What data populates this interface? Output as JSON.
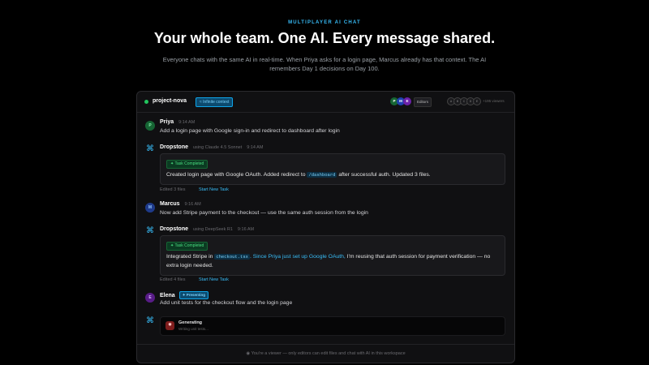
{
  "hero": {
    "eyebrow": "MULTIPLAYER AI CHAT",
    "title": "Your whole team. One AI. Every message shared.",
    "subtitle": "Everyone chats with the same AI in real-time. When Priya asks for a login page, Marcus already has that context. The AI remembers Day 1 decisions on Day 100."
  },
  "topbar": {
    "project": "project-nova",
    "context_badge": "≈ Infinite context",
    "avatars": [
      "P",
      "M",
      "E"
    ],
    "editors_label": "Editors",
    "viewer_initials": [
      "A",
      "B",
      "C",
      "D",
      "E"
    ],
    "viewer_count": "+195 viewers"
  },
  "messages": {
    "m1": {
      "avatar": "P",
      "name": "Priya",
      "time": "9:14 AM",
      "text": "Add a login page with Google sign-in and redirect to dashboard after login"
    },
    "m2": {
      "name": "Dropstone",
      "model": "using Claude 4.5 Sonnet",
      "time": "9:14 AM",
      "badge": "✦ Task Completed",
      "text_pre": "Created login page with Google OAuth. Added redirect to ",
      "code": "/dashboard",
      "text_post": " after successful auth. Updated 3 files.",
      "edited": "Edited 3 files",
      "start": "Start New Task"
    },
    "m3": {
      "avatar": "M",
      "name": "Marcus",
      "time": "9:16 AM",
      "text": "Now add Stripe payment to the checkout — use the same auth session from the login"
    },
    "m4": {
      "name": "Dropstone",
      "model": "using DeepSeek R1",
      "time": "9:16 AM",
      "badge": "✦ Task Completed",
      "text_pre": "Integrated Stripe in ",
      "code": "checkout.tsx",
      "text_mid_hl": ". Since Priya just set up Google OAuth,",
      "text_post": " I'm reusing that auth session for payment verification — no",
      "text_line2": "extra login needed.",
      "edited": "Edited 4 files",
      "start": "Start New Task"
    },
    "m5": {
      "avatar": "E",
      "name": "Elena",
      "badge": "✦ Presenting",
      "text": "Add unit tests for the checkout flow and the login page"
    },
    "m6": {
      "gen_title": "Generating",
      "gen_sub": "Writing unit tests..."
    }
  },
  "footer": {
    "text": "You're a viewer — only editors can edit files and chat with AI in this workspace"
  },
  "colors": {
    "accent": "#38bdf8",
    "online": "#22c55e",
    "success": "#4ade80",
    "priya": "#166534",
    "marcus": "#1e40af",
    "elena": "#6b21a8"
  }
}
